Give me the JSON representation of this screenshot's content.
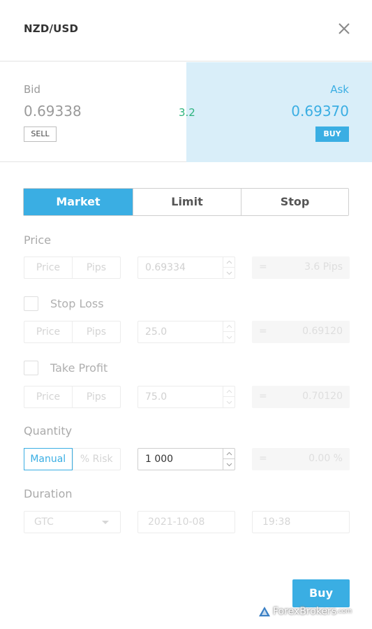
{
  "header": {
    "title": "NZD/USD",
    "close_icon": "close-icon"
  },
  "quote": {
    "bid_label": "Bid",
    "bid_price": "0.69338",
    "sell_label": "SELL",
    "spread": "3.2",
    "ask_label": "Ask",
    "ask_price": "0.69370",
    "buy_label": "BUY"
  },
  "order_tabs": [
    {
      "label": "Market",
      "active": true
    },
    {
      "label": "Limit",
      "active": false
    },
    {
      "label": "Stop",
      "active": false
    }
  ],
  "price": {
    "label": "Price",
    "modes": [
      "Price",
      "Pips"
    ],
    "value": "0.69334",
    "result_eq": "=",
    "result": "3.6 Pips"
  },
  "stop_loss": {
    "label": "Stop Loss",
    "checked": false,
    "modes": [
      "Price",
      "Pips"
    ],
    "value": "25.0",
    "result_eq": "=",
    "result": "0.69120"
  },
  "take_profit": {
    "label": "Take Profit",
    "checked": false,
    "modes": [
      "Price",
      "Pips"
    ],
    "value": "75.0",
    "result_eq": "=",
    "result": "0.70120"
  },
  "quantity": {
    "label": "Quantity",
    "modes": [
      "Manual",
      "% Risk"
    ],
    "active_mode": "Manual",
    "value": "1 000",
    "result_eq": "=",
    "result": "0.00 %"
  },
  "duration": {
    "label": "Duration",
    "type": "GTC",
    "date": "2021-10-08",
    "time": "19:38"
  },
  "submit": {
    "label": "Buy"
  },
  "watermark": {
    "brand": "ForexBrokers",
    "suffix": ".com"
  },
  "colors": {
    "accent": "#3aaee3",
    "ask_bg": "#d9eef9",
    "spread": "#2db37d"
  }
}
